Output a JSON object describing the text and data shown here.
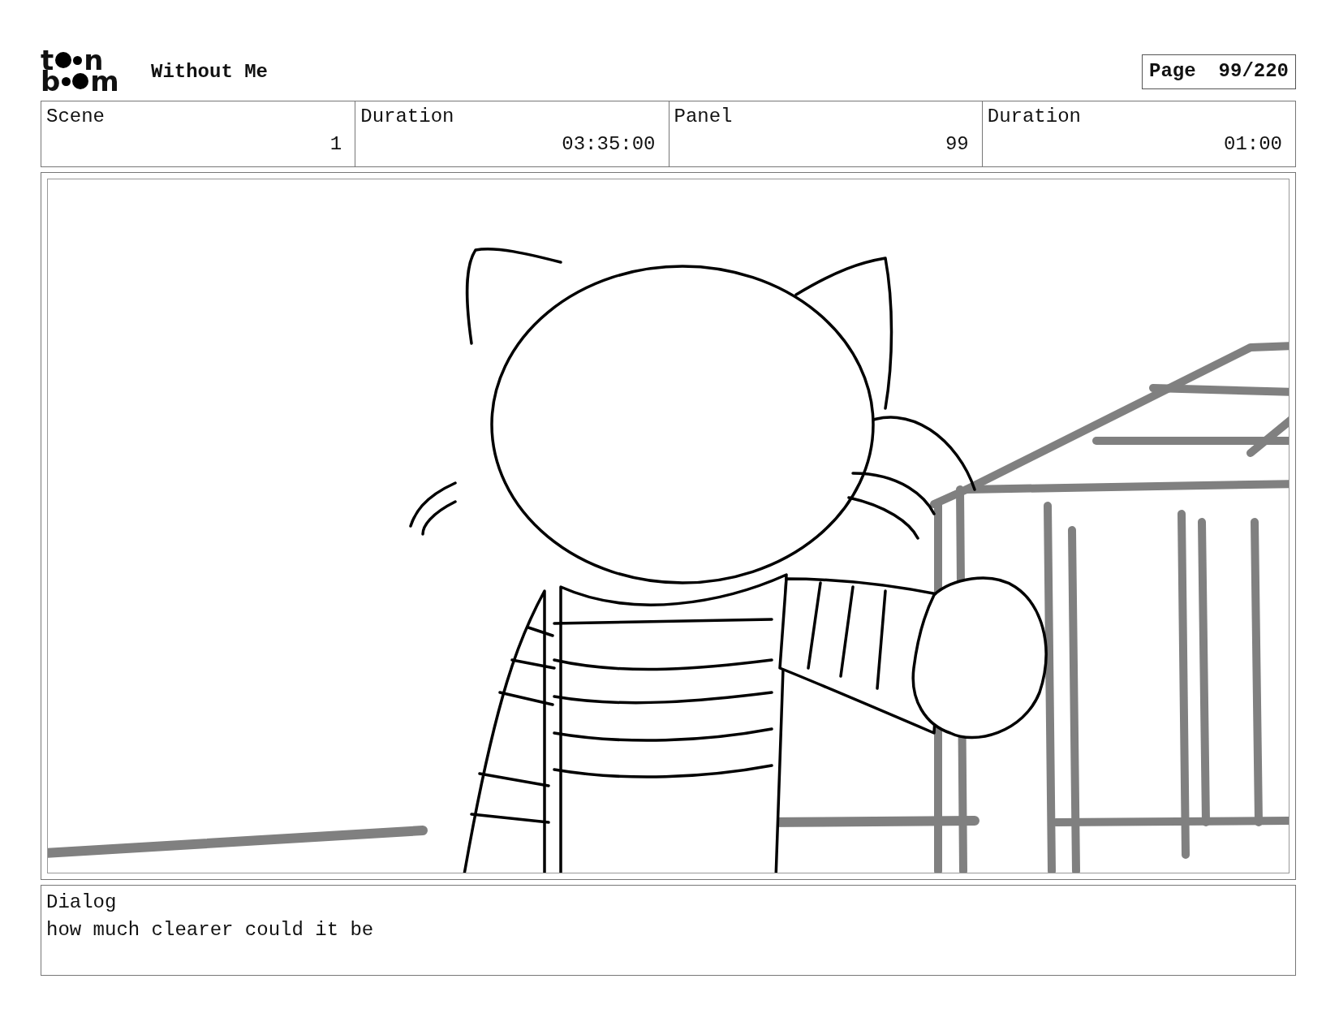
{
  "logo": {
    "top": [
      "t",
      "n"
    ],
    "bottom": [
      "b",
      "m"
    ]
  },
  "title": "Without Me",
  "page": {
    "label": "Page",
    "value": "99/220"
  },
  "info": [
    {
      "label": "Scene",
      "value": "1"
    },
    {
      "label": "Duration",
      "value": "03:35:00"
    },
    {
      "label": "Panel",
      "value": "99"
    },
    {
      "label": "Duration",
      "value": "01:00"
    }
  ],
  "dialog": {
    "label": "Dialog",
    "text": "how much clearer could it be"
  }
}
